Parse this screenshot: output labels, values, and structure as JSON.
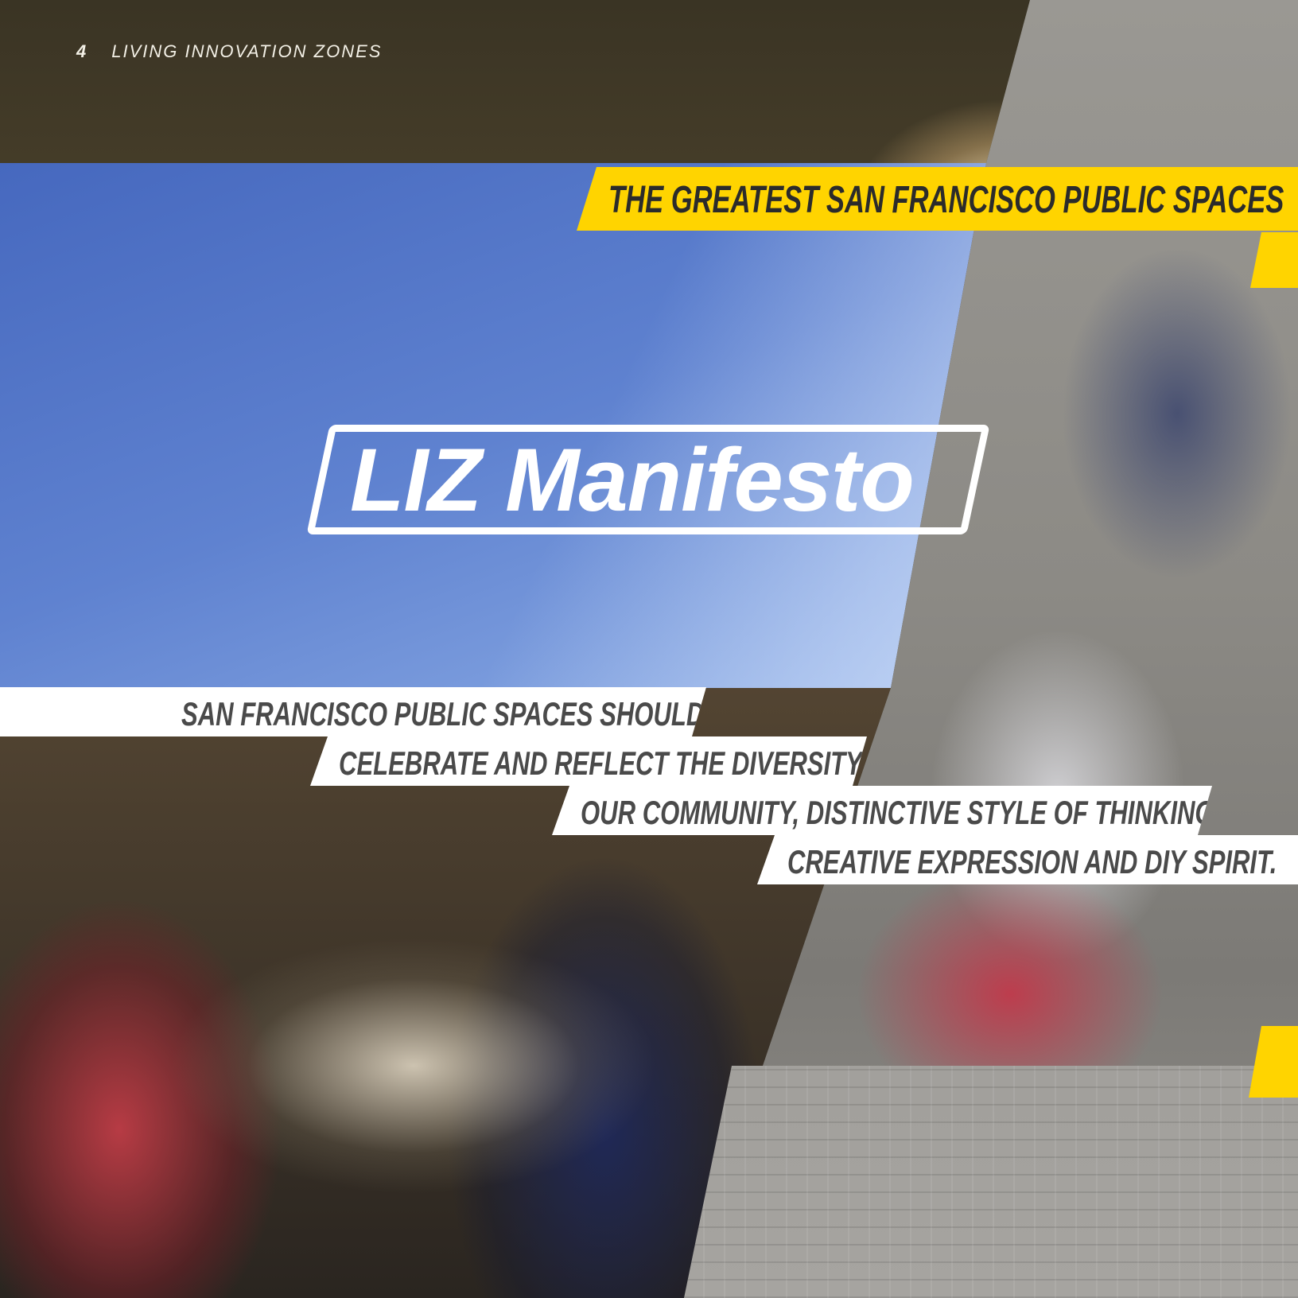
{
  "header": {
    "page_number": "4",
    "section_title": "LIVING INNOVATION ZONES"
  },
  "banner": {
    "text": "THE GREATEST SAN FRANCISCO PUBLIC SPACES"
  },
  "title": {
    "text": "LIZ Manifesto"
  },
  "manifesto_lines": [
    "SAN FRANCISCO PUBLIC SPACES SHOULD",
    "CELEBRATE AND REFLECT THE DIVERSITY OF",
    "OUR COMMUNITY, DISTINCTIVE STYLE OF THINKING,",
    "CREATIVE EXPRESSION AND DIY SPIRIT."
  ],
  "colors": {
    "accent_yellow": "#ffd400",
    "strip_white": "#ffffff",
    "strip_text": "#4a4a4a"
  }
}
